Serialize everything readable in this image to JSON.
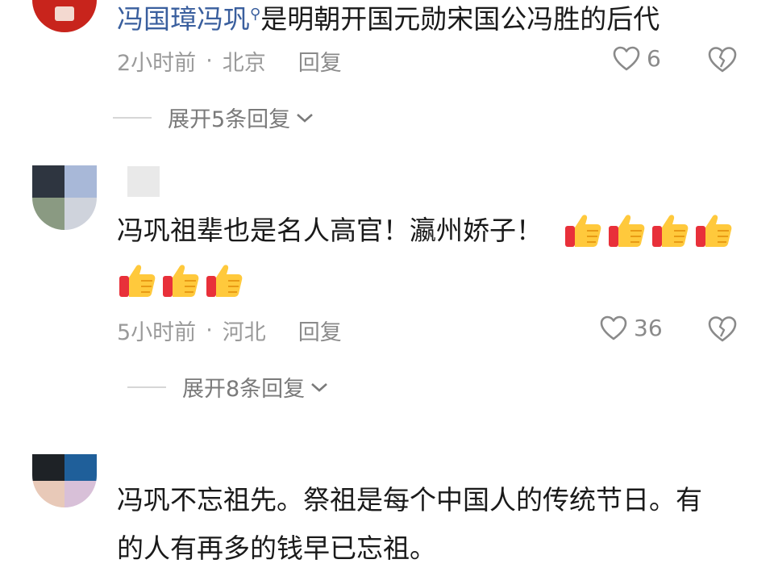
{
  "comments": [
    {
      "mention": "冯国璋冯巩",
      "text": "是明朝开国元勋宋国公冯胜的后代",
      "time": "2小时前",
      "location": "北京",
      "reply_label": "回复",
      "likes": "6",
      "expand_label": "展开5条回复"
    },
    {
      "text_line1": "冯巩祖辈也是名人高官！瀛州娇子！",
      "time": "5小时前",
      "location": "河北",
      "reply_label": "回复",
      "likes": "36",
      "expand_label": "展开8条回复",
      "emoji_line1_count": 4,
      "emoji_line2_count": 3
    },
    {
      "text_line1": "冯巩不忘祖先。祭祖是每个中国人的传统节日。有",
      "text_line2": "的人有再多的钱早已忘祖。"
    }
  ],
  "icons": {
    "like": "heart-outline-icon",
    "dislike": "broken-heart-icon",
    "expand": "chevron-down-icon",
    "thumbs": "thumbs-up-emoji",
    "mention": "search-magnifier-icon"
  },
  "colors": {
    "text": "#1a1a1a",
    "meta": "#9a9a9a",
    "mention": "#3a5f9e",
    "avatar_red": "#c8241c"
  }
}
